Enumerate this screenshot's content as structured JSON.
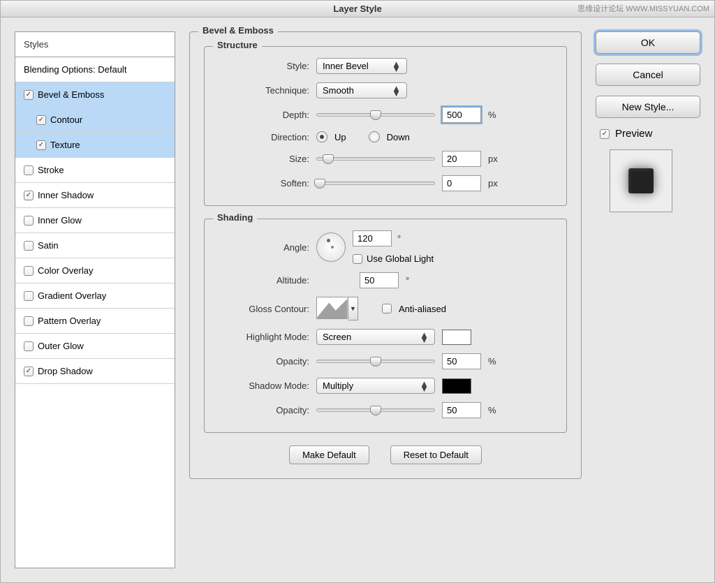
{
  "window": {
    "title": "Layer Style"
  },
  "watermark": {
    "topRight": "思缘设计论坛  WWW.MISSYUAN.COM"
  },
  "sidebar": {
    "header": "Styles",
    "blending": "Blending Options: Default",
    "items": [
      {
        "label": "Bevel & Emboss",
        "checked": true,
        "selected": true,
        "indent": false
      },
      {
        "label": "Contour",
        "checked": true,
        "selected": true,
        "indent": true
      },
      {
        "label": "Texture",
        "checked": true,
        "selected": true,
        "indent": true
      },
      {
        "label": "Stroke",
        "checked": false,
        "selected": false,
        "indent": false
      },
      {
        "label": "Inner Shadow",
        "checked": true,
        "selected": false,
        "indent": false
      },
      {
        "label": "Inner Glow",
        "checked": false,
        "selected": false,
        "indent": false
      },
      {
        "label": "Satin",
        "checked": false,
        "selected": false,
        "indent": false
      },
      {
        "label": "Color Overlay",
        "checked": false,
        "selected": false,
        "indent": false
      },
      {
        "label": "Gradient Overlay",
        "checked": false,
        "selected": false,
        "indent": false
      },
      {
        "label": "Pattern Overlay",
        "checked": false,
        "selected": false,
        "indent": false
      },
      {
        "label": "Outer Glow",
        "checked": false,
        "selected": false,
        "indent": false
      },
      {
        "label": "Drop Shadow",
        "checked": true,
        "selected": false,
        "indent": false
      }
    ]
  },
  "panel": {
    "title": "Bevel & Emboss",
    "structure": {
      "legend": "Structure",
      "style_label": "Style:",
      "style_value": "Inner Bevel",
      "technique_label": "Technique:",
      "technique_value": "Smooth",
      "depth_label": "Depth:",
      "depth_value": "500",
      "depth_unit": "%",
      "direction_label": "Direction:",
      "up_label": "Up",
      "down_label": "Down",
      "size_label": "Size:",
      "size_value": "20",
      "size_unit": "px",
      "soften_label": "Soften:",
      "soften_value": "0",
      "soften_unit": "px"
    },
    "shading": {
      "legend": "Shading",
      "angle_label": "Angle:",
      "angle_value": "120",
      "angle_unit": "°",
      "global_light_label": "Use Global Light",
      "altitude_label": "Altitude:",
      "altitude_value": "50",
      "altitude_unit": "°",
      "gloss_label": "Gloss Contour:",
      "antialias_label": "Anti-aliased",
      "highlight_label": "Highlight Mode:",
      "highlight_value": "Screen",
      "highlight_color": "#ffffff",
      "opacity_label": "Opacity:",
      "highlight_opacity": "50",
      "opacity_unit": "%",
      "shadow_label": "Shadow Mode:",
      "shadow_value": "Multiply",
      "shadow_color": "#000000",
      "shadow_opacity": "50"
    },
    "buttons": {
      "make_default": "Make Default",
      "reset": "Reset to Default"
    }
  },
  "actions": {
    "ok": "OK",
    "cancel": "Cancel",
    "new_style": "New Style...",
    "preview": "Preview"
  }
}
